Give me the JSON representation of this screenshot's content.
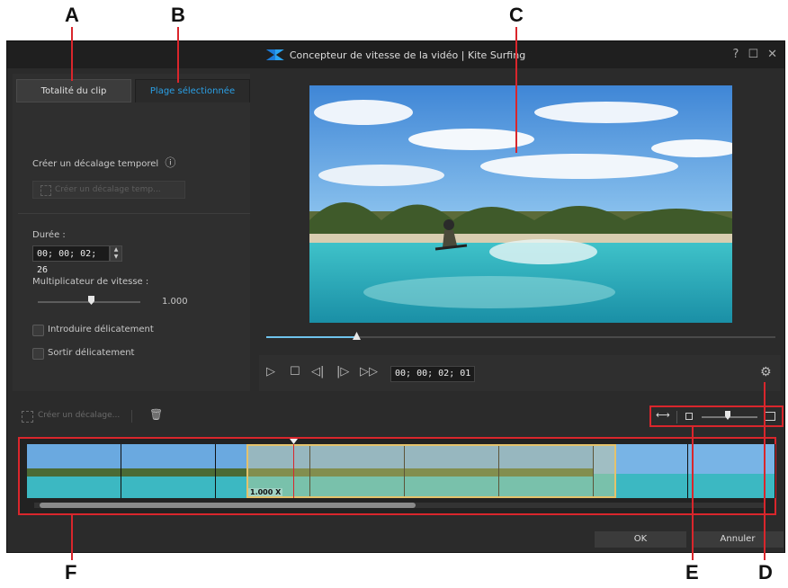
{
  "callouts": {
    "a": "A",
    "b": "B",
    "c": "C",
    "d": "D",
    "e": "E",
    "f": "F"
  },
  "window": {
    "title": "Concepteur de vitesse de la vidéo  |  Kite Surfing",
    "help": "?",
    "maximize": "☐",
    "close": "✕"
  },
  "tabs": {
    "whole_clip": "Totalité du clip",
    "selected_range": "Plage sélectionnée"
  },
  "left": {
    "time_shift_label": "Créer un décalage temporel",
    "info_icon": "ⓘ",
    "time_shift_button": "Créer un décalage temp...",
    "duration_label": "Durée :",
    "duration_value": "00; 00; 02; 26",
    "speed_label": "Multiplicateur de vitesse :",
    "speed_value": "1.000",
    "ease_in": "Introduire délicatement",
    "ease_out": "Sortir délicatement"
  },
  "player": {
    "timecode": "00; 00; 02; 01",
    "play": "▷",
    "stop": "☐",
    "prev_frame": "◁|",
    "next_frame": "|▷",
    "fast_forward": "▷▷",
    "settings": "⚙"
  },
  "timeline": {
    "create_shift": "Créer un décalage...",
    "trash_icon": "🗑",
    "speed_badge": "1.000 X"
  },
  "footer": {
    "ok": "OK",
    "cancel": "Annuler"
  },
  "colors": {
    "accent": "#2aa0e6",
    "highlight": "#d9262c",
    "selection": "#e4c26c"
  }
}
